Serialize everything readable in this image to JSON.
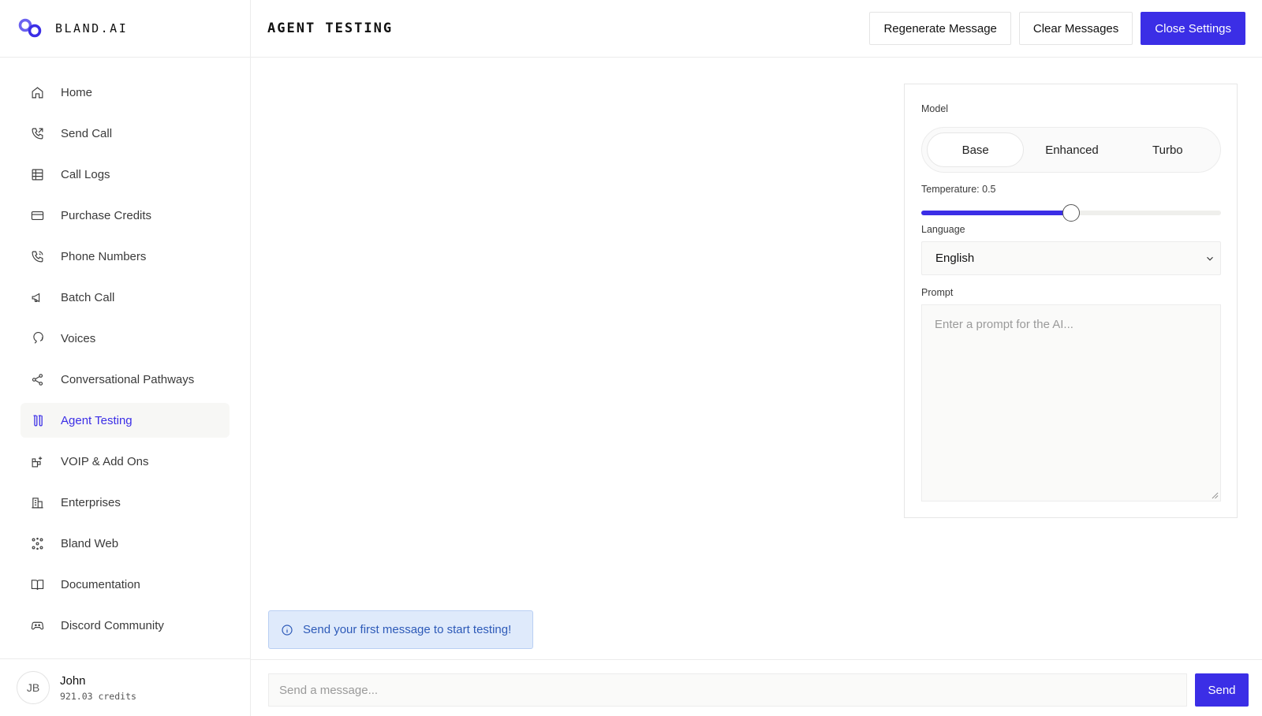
{
  "brand": {
    "name": "BLAND.AI",
    "accent_color": "#3b2ee6"
  },
  "sidebar": {
    "items": [
      {
        "label": "Home",
        "icon": "home-icon"
      },
      {
        "label": "Send Call",
        "icon": "phone-outgoing-icon"
      },
      {
        "label": "Call Logs",
        "icon": "table-icon"
      },
      {
        "label": "Purchase Credits",
        "icon": "credit-card-icon"
      },
      {
        "label": "Phone Numbers",
        "icon": "phone-icon"
      },
      {
        "label": "Batch Call",
        "icon": "megaphone-icon"
      },
      {
        "label": "Voices",
        "icon": "speech-bubble-icon"
      },
      {
        "label": "Conversational Pathways",
        "icon": "share-nodes-icon"
      },
      {
        "label": "Agent Testing",
        "icon": "test-tubes-icon",
        "active": true
      },
      {
        "label": "VOIP & Add Ons",
        "icon": "blocks-plus-icon"
      },
      {
        "label": "Enterprises",
        "icon": "building-icon"
      },
      {
        "label": "Bland Web",
        "icon": "dots-network-icon"
      },
      {
        "label": "Documentation",
        "icon": "book-open-icon"
      },
      {
        "label": "Discord Community",
        "icon": "gamepad-icon"
      }
    ]
  },
  "user": {
    "initials": "JB",
    "name": "John",
    "credits": "921.03 credits"
  },
  "header": {
    "title": "AGENT TESTING",
    "regenerate_label": "Regenerate Message",
    "clear_label": "Clear Messages",
    "close_label": "Close Settings"
  },
  "settings": {
    "model_label": "Model",
    "model_options": [
      "Base",
      "Enhanced",
      "Turbo"
    ],
    "model_selected": "Base",
    "temperature_label": "Temperature: 0.5",
    "temperature_value": 0.5,
    "language_label": "Language",
    "language_value": "English",
    "prompt_label": "Prompt",
    "prompt_placeholder": "Enter a prompt for the AI..."
  },
  "chat": {
    "info_text": "Send your first message to start testing!",
    "input_placeholder": "Send a message...",
    "send_label": "Send"
  }
}
